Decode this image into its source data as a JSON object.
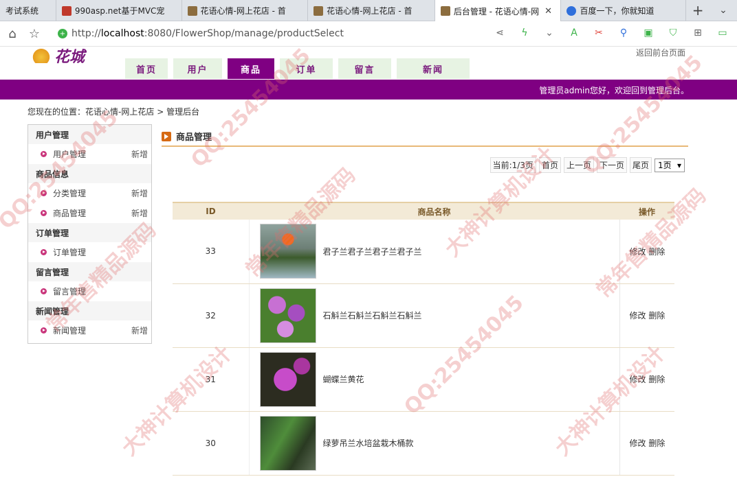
{
  "browser": {
    "tabs": [
      {
        "title": "考试系统",
        "favicon_color": "#e8e8e8"
      },
      {
        "title": "990asp.net基于MVC宠",
        "favicon_color": "#c0392b"
      },
      {
        "title": "花语心情-网上花店 - 首",
        "favicon_color": "#8c6d3f"
      },
      {
        "title": "花语心情-网上花店 - 首",
        "favicon_color": "#8c6d3f"
      },
      {
        "title": "后台管理 - 花语心情-网",
        "favicon_color": "#8c6d3f",
        "active": true
      },
      {
        "title": "百度一下，你就知道",
        "favicon_color": "#2f6fdb"
      }
    ],
    "url_prefix": "http://",
    "url_host": "localhost",
    "url_path": ":8080/FlowerShop/manage/productSelect"
  },
  "site": {
    "logo_text": "花城",
    "top_right_text": "返回前台页面",
    "nav": [
      "首页",
      "用户",
      "商品",
      "订单",
      "留言",
      "新闻"
    ],
    "active_nav": 2,
    "welcome": "管理员admin您好，欢迎回到管理后台。"
  },
  "breadcrumb": {
    "prefix": "您现在的位置：",
    "home": "花语心情-网上花店",
    "sep": ">",
    "current": "管理后台"
  },
  "sidebar": {
    "groups": [
      {
        "title": "用户管理",
        "items": [
          {
            "label": "用户管理",
            "add": "新增"
          }
        ]
      },
      {
        "title": "商品信息",
        "items": [
          {
            "label": "分类管理",
            "add": "新增"
          },
          {
            "label": "商品管理",
            "add": "新增"
          }
        ]
      },
      {
        "title": "订单管理",
        "items": [
          {
            "label": "订单管理",
            "add": ""
          }
        ]
      },
      {
        "title": "留言管理",
        "items": [
          {
            "label": "留言管理",
            "add": ""
          }
        ]
      },
      {
        "title": "新闻管理",
        "items": [
          {
            "label": "新闻管理",
            "add": "新增"
          }
        ]
      }
    ]
  },
  "main": {
    "title": "商品管理",
    "pager": {
      "current": "当前:1/3页",
      "first": "首页",
      "prev": "上一页",
      "next": "下一页",
      "last": "尾页",
      "select_value": "1页"
    },
    "table": {
      "headers": [
        "ID",
        "商品名称",
        "操作"
      ],
      "rows": [
        {
          "id": "33",
          "name": "君子兰君子兰君子兰君子兰",
          "edit": "修改",
          "del": "删除"
        },
        {
          "id": "32",
          "name": "石斛兰石斛兰石斛兰石斛兰",
          "edit": "修改",
          "del": "删除"
        },
        {
          "id": "31",
          "name": "蝴蝶兰黄花",
          "edit": "修改",
          "del": "删除"
        },
        {
          "id": "30",
          "name": "绿萝吊兰水培盆栽木桶款",
          "edit": "修改",
          "del": "删除"
        }
      ]
    }
  },
  "watermarks": [
    "QQ:25454045",
    "常年售精品源码",
    "大神计算机设计",
    "QQ:25454045",
    "常年售精品源码",
    "大神计算机设计",
    "QQ:25454045",
    "QQ:25454045",
    "常年售精品源码",
    "大神计算机设计"
  ]
}
